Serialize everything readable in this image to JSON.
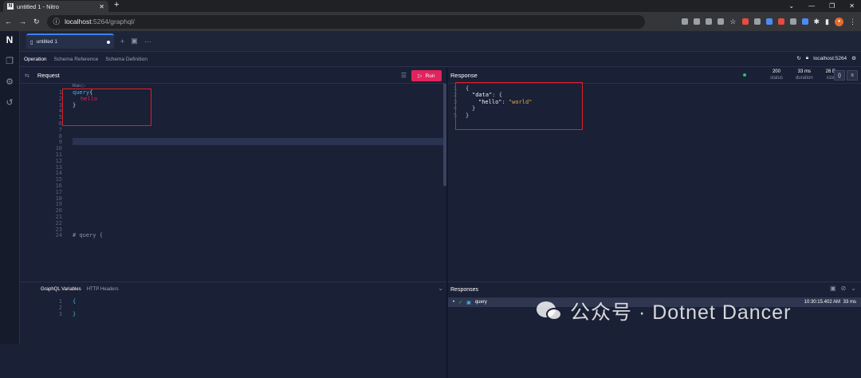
{
  "browser": {
    "tab_title": "untitled 1 - Nitro",
    "tab_favicon": "N",
    "new_tab": "+",
    "url_host": "localhost",
    "url_rest": ":5264/graphql/"
  },
  "app": {
    "logo": "N",
    "doc_tab": "untitled 1",
    "subnav": {
      "operation": "Operation",
      "schema_reference": "Schema Reference",
      "schema_definition": "Schema Definition"
    },
    "endpoint": "localhost:5264"
  },
  "request": {
    "title": "Request",
    "run_label": "Run",
    "run_lens": "Run ▷",
    "line_numbers": [
      "1",
      "2",
      "3",
      "4",
      "5",
      "6",
      "7",
      "8",
      "9",
      "10",
      "11",
      "12",
      "13",
      "14",
      "15",
      "16",
      "17",
      "18",
      "19",
      "20",
      "21",
      "22",
      "23",
      "24"
    ],
    "query_keyword": "query",
    "open_brace": "{",
    "field": "hello",
    "close_brace": "}",
    "trailing_comment": "# query {"
  },
  "response": {
    "title": "Response",
    "status": {
      "value": "200",
      "label": "status"
    },
    "duration": {
      "value": "33 ms",
      "label": "duration"
    },
    "size": {
      "value": "26 B",
      "label": "size"
    },
    "line_numbers": [
      "1",
      "2",
      "3",
      "4",
      "5"
    ],
    "json_open": "{",
    "data_key": "\"data\"",
    "colon_brace": ": {",
    "hello_key": "\"hello\"",
    "colon": ": ",
    "hello_value": "\"world\"",
    "inner_close": "}",
    "outer_close": "}"
  },
  "variables": {
    "tab_variables": "GraphQL Variables",
    "tab_headers": "HTTP Headers",
    "line_numbers": [
      "1",
      "2",
      "3"
    ],
    "open": "{",
    "close": "}"
  },
  "responses_panel": {
    "title": "Responses",
    "item_name": "query",
    "item_time": "10:30:15.402 AM",
    "item_duration": "33 ms"
  },
  "watermark": "公众号 · Dotnet Dancer",
  "colors": {
    "run": "#e0245e",
    "status_ok": "#22c55e",
    "annotation": "#e01e2b",
    "keyword": "#3fb6e8"
  }
}
